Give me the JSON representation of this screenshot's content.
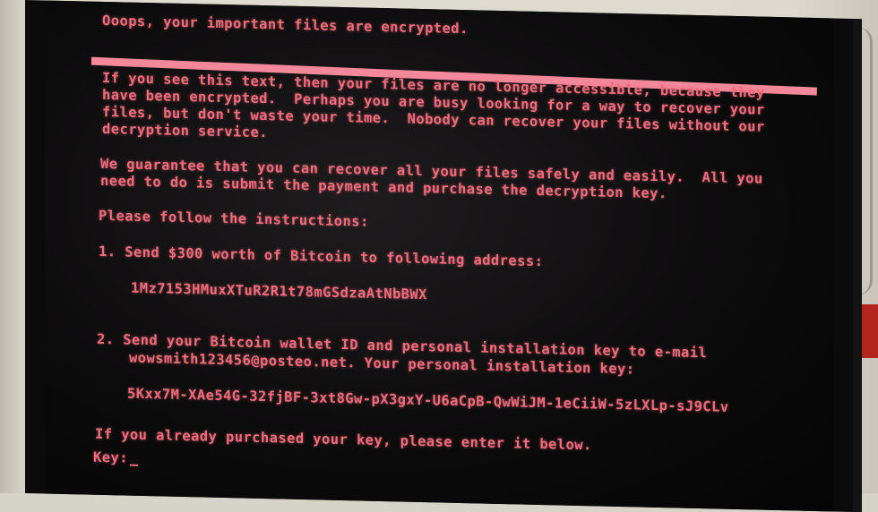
{
  "header": "Ooops, your important files are encrypted.",
  "intro": {
    "line1": "If you see this text, then your files are no longer accessible, because they",
    "line2": "have been encrypted.  Perhaps you are busy looking for a way to recover your",
    "line3": "files, but don't waste your time.  Nobody can recover your files without our",
    "line4": "decryption service."
  },
  "guarantee": {
    "line1": "We guarantee that you can recover all your files safely and easily.  All you",
    "line2": "need to do is submit the payment and purchase the decryption key."
  },
  "instructions_heading": "Please follow the instructions:",
  "step1": {
    "text": "1. Send $300 worth of Bitcoin to following address:",
    "address": "1Mz7153HMuxXTuR2R1t78mGSdzaAtNbBWX"
  },
  "step2": {
    "line1": "2. Send your Bitcoin wallet ID and personal installation key to e-mail",
    "line2": "wowsmith123456@posteo.net. Your personal installation key:",
    "key": "5Kxx7M-XAe54G-32fjBF-3xt8Gw-pX3gxY-U6aCpB-QwWiJM-1eCiiW-5zLXLp-sJ9CLv"
  },
  "footer": {
    "prompt": "If you already purchased your key, please enter it below.",
    "key_label": "Key:"
  },
  "colors": {
    "text": "#f06b7c",
    "background": "#0b0b0c"
  }
}
